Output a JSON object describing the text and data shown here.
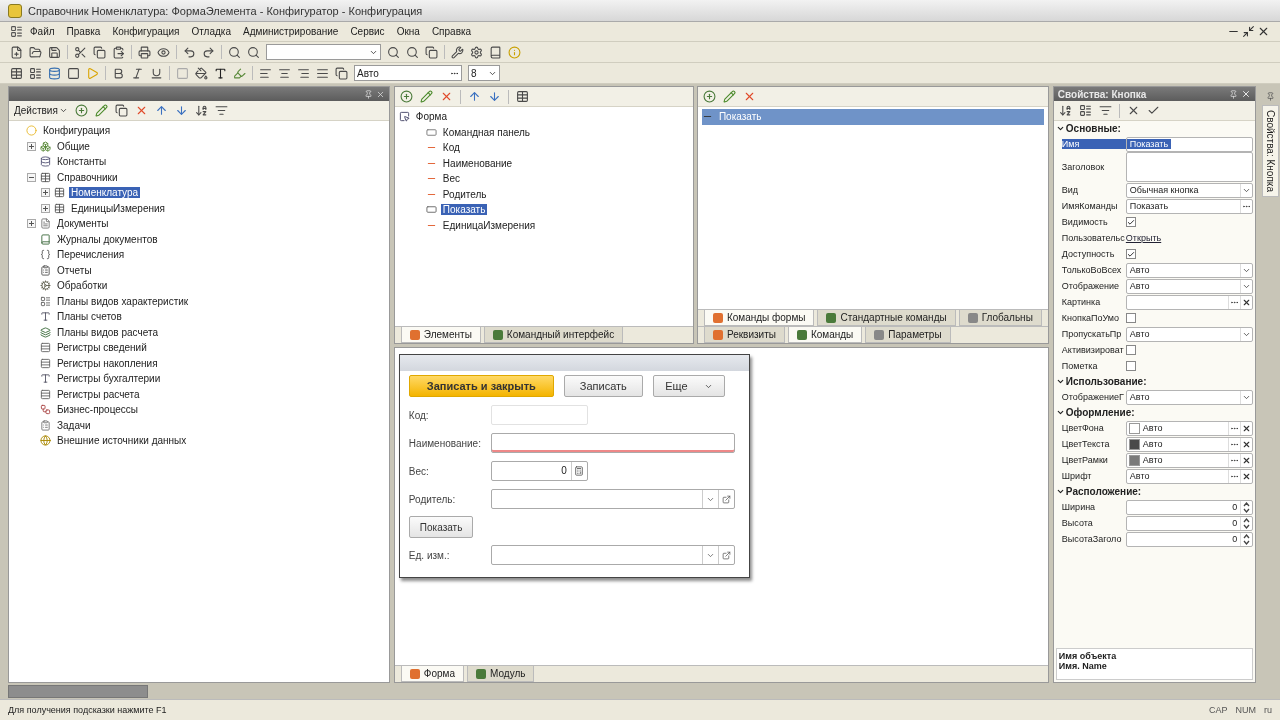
{
  "window": {
    "title": "Справочник Номенклатура: ФормаЭлемента - Конфигуратор - Конфигурация"
  },
  "menu": [
    {
      "label": "Файл"
    },
    {
      "label": "Правка"
    },
    {
      "label": "Конфигурация"
    },
    {
      "label": "Отладка"
    },
    {
      "label": "Администрирование"
    },
    {
      "label": "Сервис"
    },
    {
      "label": "Окна"
    },
    {
      "label": "Справка"
    }
  ],
  "format_toolbar": {
    "font": "Авто",
    "size": "8"
  },
  "config_tree": {
    "actions": "Действия",
    "items": [
      {
        "label": "Конфигурация",
        "kind": "root",
        "selected": false,
        "children": [
          {
            "label": "Общие",
            "kind": "common",
            "selected": false,
            "expanded": false
          },
          {
            "label": "Константы",
            "kind": "constants",
            "selected": false
          },
          {
            "label": "Справочники",
            "kind": "catalogs",
            "selected": false,
            "expanded": true,
            "children": [
              {
                "label": "Номенклатура",
                "kind": "catalog",
                "selected": true,
                "expanded": false
              },
              {
                "label": "ЕдиницыИзмерения",
                "kind": "catalog",
                "selected": false,
                "expanded": false
              }
            ]
          },
          {
            "label": "Документы",
            "kind": "documents",
            "selected": false,
            "expanded": false
          },
          {
            "label": "Журналы документов",
            "kind": "journals",
            "selected": false
          },
          {
            "label": "Перечисления",
            "kind": "enums",
            "selected": false
          },
          {
            "label": "Отчеты",
            "kind": "reports",
            "selected": false
          },
          {
            "label": "Обработки",
            "kind": "processing",
            "selected": false
          },
          {
            "label": "Планы видов характеристик",
            "kind": "table",
            "selected": false
          },
          {
            "label": "Планы счетов",
            "kind": "accounts",
            "selected": false
          },
          {
            "label": "Планы видов расчета",
            "kind": "calc",
            "selected": false
          },
          {
            "label": "Регистры сведений",
            "kind": "register",
            "selected": false
          },
          {
            "label": "Регистры накопления",
            "kind": "register",
            "selected": false
          },
          {
            "label": "Регистры бухгалтерии",
            "kind": "accounts",
            "selected": false
          },
          {
            "label": "Регистры расчета",
            "kind": "register",
            "selected": false
          },
          {
            "label": "Бизнес-процессы",
            "kind": "process",
            "selected": false
          },
          {
            "label": "Задачи",
            "kind": "tasks",
            "selected": false
          },
          {
            "label": "Внешние источники данных",
            "kind": "external",
            "selected": false
          }
        ]
      }
    ]
  },
  "elements_tree": {
    "items": [
      {
        "label": "Форма",
        "kind": "form",
        "selected": false,
        "children": [
          {
            "label": "Командная панель",
            "kind": "panel",
            "selected": false
          },
          {
            "label": "Код",
            "kind": "field",
            "selected": false
          },
          {
            "label": "Наименование",
            "kind": "field",
            "selected": false
          },
          {
            "label": "Вес",
            "kind": "field",
            "selected": false
          },
          {
            "label": "Родитель",
            "kind": "field",
            "selected": false
          },
          {
            "label": "Показать",
            "kind": "button",
            "selected": true
          },
          {
            "label": "ЕдиницаИзмерения",
            "kind": "field",
            "selected": false
          }
        ]
      }
    ],
    "tabs": [
      {
        "label": "Элементы",
        "selected": true
      },
      {
        "label": "Командный интерфейс",
        "selected": false
      }
    ]
  },
  "commands": {
    "items": [
      {
        "label": "Показать",
        "selected": true
      }
    ],
    "tabs": [
      {
        "label": "Команды формы",
        "selected": true
      },
      {
        "label": "Стандартные команды",
        "selected": false
      },
      {
        "label": "Глобальны",
        "selected": false
      }
    ],
    "lower_tabs": [
      {
        "label": "Реквизиты",
        "selected": false
      },
      {
        "label": "Команды",
        "selected": true
      },
      {
        "label": "Параметры",
        "selected": false
      }
    ]
  },
  "form_preview": {
    "buttons": [
      {
        "label": "Записать и закрыть",
        "kind": "primary"
      },
      {
        "label": "Записать",
        "kind": "plain"
      },
      {
        "label": "Еще",
        "kind": "menu"
      }
    ],
    "fields": [
      {
        "kind": "text",
        "label": "Код:",
        "disabled": true,
        "required": false
      },
      {
        "kind": "text",
        "label": "Наименование:",
        "disabled": false,
        "required": true
      },
      {
        "kind": "number",
        "label": "Вес:",
        "value": "0",
        "disabled": false,
        "required": false
      },
      {
        "kind": "reference",
        "label": "Родитель:",
        "disabled": false,
        "required": false
      },
      {
        "kind": "button",
        "label": "Показать"
      },
      {
        "kind": "reference",
        "label": "Ед. изм.:",
        "disabled": false,
        "required": false
      }
    ]
  },
  "designer_tabs": [
    {
      "label": "Форма",
      "selected": true
    },
    {
      "label": "Модуль",
      "selected": false
    }
  ],
  "properties": {
    "title": "Свойства: Кнопка",
    "side_tab": "Свойства: Кнопка",
    "groups": [
      {
        "title": "Основные:",
        "expanded": true,
        "rows": [
          {
            "label": "Имя",
            "kind": "text",
            "value": "Показать",
            "selected": true
          },
          {
            "label": "Заголовок",
            "kind": "textarea",
            "selected": false
          },
          {
            "label": "Вид",
            "kind": "select",
            "value": "Обычная кнопка",
            "selected": false
          },
          {
            "label": "ИмяКоманды",
            "kind": "choice",
            "value": "Показать",
            "selected": false
          },
          {
            "label": "Видимость",
            "kind": "checkbox",
            "checked": true,
            "selected": false
          },
          {
            "label": "Пользовательс",
            "kind": "link",
            "value": "Открыть",
            "selected": false
          },
          {
            "label": "Доступность",
            "kind": "checkbox",
            "checked": true,
            "selected": false
          },
          {
            "label": "ТолькоВоВсех",
            "kind": "select",
            "value": "Авто",
            "selected": false
          },
          {
            "label": "Отображение",
            "kind": "select",
            "value": "Авто",
            "selected": false
          },
          {
            "label": "Картинка",
            "kind": "picker",
            "selected": false
          },
          {
            "label": "КнопкаПоУмо",
            "kind": "checkbox",
            "checked": false,
            "selected": false
          },
          {
            "label": "ПропускатьПр",
            "kind": "select",
            "value": "Авто",
            "selected": false
          },
          {
            "label": "Активизироват",
            "kind": "checkbox",
            "checked": false,
            "selected": false
          },
          {
            "label": "Пометка",
            "kind": "checkbox",
            "checked": false,
            "selected": false
          }
        ]
      },
      {
        "title": "Использование:",
        "expanded": true,
        "rows": [
          {
            "label": "ОтображениеГ",
            "kind": "select",
            "value": "Авто",
            "selected": false
          }
        ]
      },
      {
        "title": "Оформление:",
        "expanded": true,
        "rows": [
          {
            "label": "ЦветФона",
            "kind": "color",
            "value": "Авто",
            "color": "#ffffff",
            "selected": false
          },
          {
            "label": "ЦветТекста",
            "kind": "color",
            "value": "Авто",
            "color": "#4a4a4a",
            "selected": false
          },
          {
            "label": "ЦветРамки",
            "kind": "color",
            "value": "Авто",
            "color": "#7a7a7a",
            "selected": false
          },
          {
            "label": "Шрифт",
            "kind": "picker",
            "value": "Авто",
            "selected": false
          }
        ]
      },
      {
        "title": "Расположение:",
        "expanded": true,
        "rows": [
          {
            "label": "Ширина",
            "kind": "spin",
            "value": "0",
            "selected": false
          },
          {
            "label": "Высота",
            "kind": "spin",
            "value": "0",
            "selected": false
          },
          {
            "label": "ВысотаЗаголо",
            "kind": "spin",
            "value": "0",
            "selected": false
          }
        ]
      }
    ],
    "description": [
      "Имя объекта",
      "Имя. Name"
    ]
  },
  "status_bar": {
    "hint": "Для получения подсказки нажмите F1",
    "indicators": [
      "CAP",
      "NUM"
    ],
    "language": "ru"
  }
}
